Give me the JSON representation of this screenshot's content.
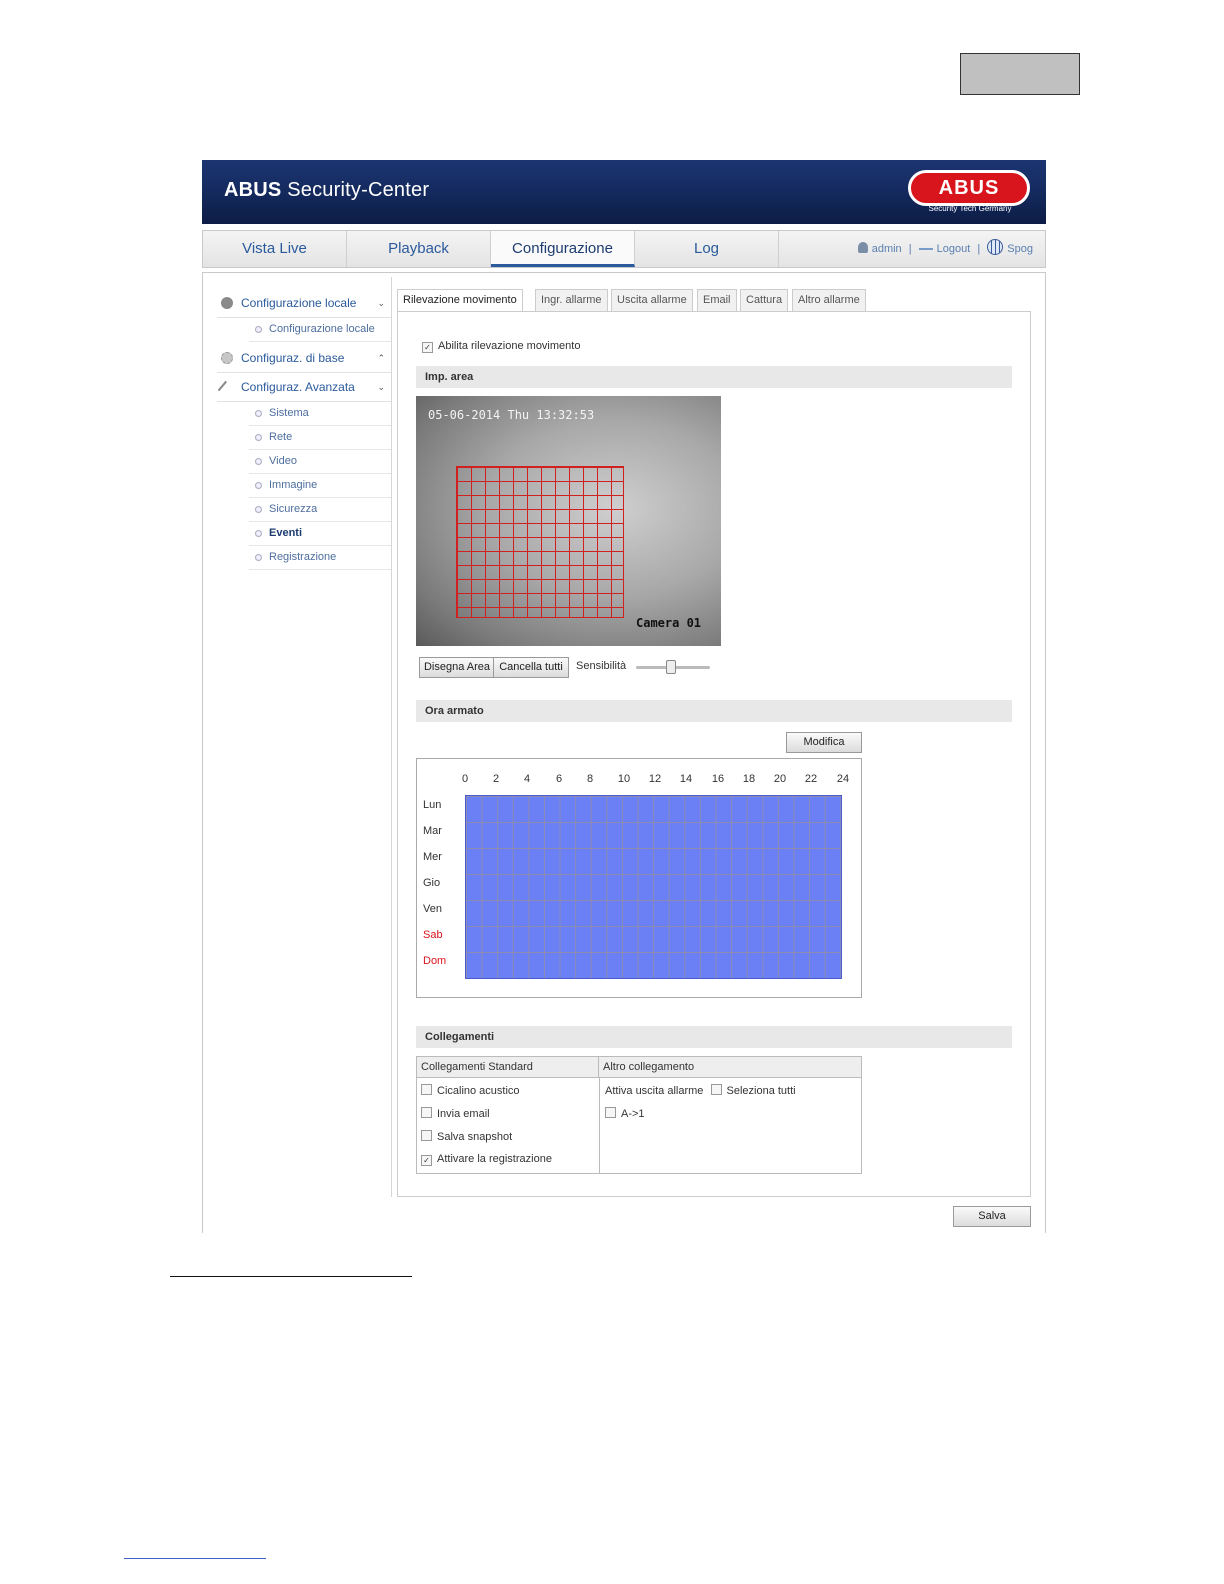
{
  "header": {
    "app_title_bold": "ABUS",
    "app_title_rest": " Security-Center",
    "logo": "ABUS",
    "logo_tagline": "Security Tech Germany"
  },
  "nav": {
    "tabs": [
      {
        "label": "Vista Live"
      },
      {
        "label": "Playback"
      },
      {
        "label": "Configurazione",
        "active": true
      },
      {
        "label": "Log"
      }
    ],
    "user": "admin",
    "separator": "|",
    "logout": "Logout",
    "language": "Spog",
    "icons": [
      "user-icon",
      "logout-icon",
      "globe-icon"
    ]
  },
  "sidebar": {
    "sections": [
      {
        "label": "Configurazione locale",
        "caret": "⌄",
        "icon": "camera-icon",
        "items": [
          "Configurazione locale"
        ]
      },
      {
        "label": "Configuraz. di base",
        "caret": "⌃",
        "icon": "gear-icon",
        "items": []
      },
      {
        "label": "Configuraz. Avanzata",
        "caret": "⌄",
        "icon": "wrench-icon",
        "items": [
          "Sistema",
          "Rete",
          "Video",
          "Immagine",
          "Sicurezza",
          "Eventi",
          "Registrazione"
        ],
        "active_item": "Eventi"
      }
    ]
  },
  "subtabs": [
    "Rilevazione movimento",
    "Ingr. allarme",
    "Uscita allarme",
    "Email",
    "Cattura",
    "Altro allarme"
  ],
  "motion": {
    "enable_label": "Abilita rilevazione movimento",
    "enable_checked": true,
    "area_section": "Imp. area",
    "camera_timestamp": "05-06-2014 Thu 13:32:53",
    "camera_name": "Camera 01",
    "draw_area_button": "Disegna Area",
    "clear_all_button": "Cancella tutti",
    "sensitivity_label": "Sensibilità",
    "sensitivity_level": 0.45
  },
  "schedule": {
    "section": "Ora armato",
    "edit_button": "Modifica",
    "hours": [
      "0",
      "2",
      "4",
      "6",
      "8",
      "10",
      "12",
      "14",
      "16",
      "18",
      "20",
      "22",
      "24"
    ],
    "days": [
      {
        "label": "Lun",
        "weekend": false
      },
      {
        "label": "Mar",
        "weekend": false
      },
      {
        "label": "Mer",
        "weekend": false
      },
      {
        "label": "Gio",
        "weekend": false
      },
      {
        "label": "Ven",
        "weekend": false
      },
      {
        "label": "Sab",
        "weekend": true
      },
      {
        "label": "Dom",
        "weekend": true
      }
    ],
    "armed_color": "#6b80f5"
  },
  "links": {
    "section": "Collegamenti",
    "standard_header": "Collegamenti Standard",
    "other_header": "Altro collegamento",
    "standard": [
      {
        "label": "Cicalino acustico",
        "checked": false
      },
      {
        "label": "Invia email",
        "checked": false
      },
      {
        "label": "Salva snapshot",
        "checked": false
      },
      {
        "label": "Attivare la registrazione",
        "checked": true
      }
    ],
    "trigger_label": "Attiva uscita allarme",
    "select_all_label": "Seleziona tutti",
    "outputs": [
      {
        "label": "A->1",
        "checked": false
      }
    ]
  },
  "save_button": "Salva",
  "colors": {
    "brand_blue": "#1c3572",
    "logo_red": "#d8141c",
    "weekend_red": "#d8141c"
  }
}
